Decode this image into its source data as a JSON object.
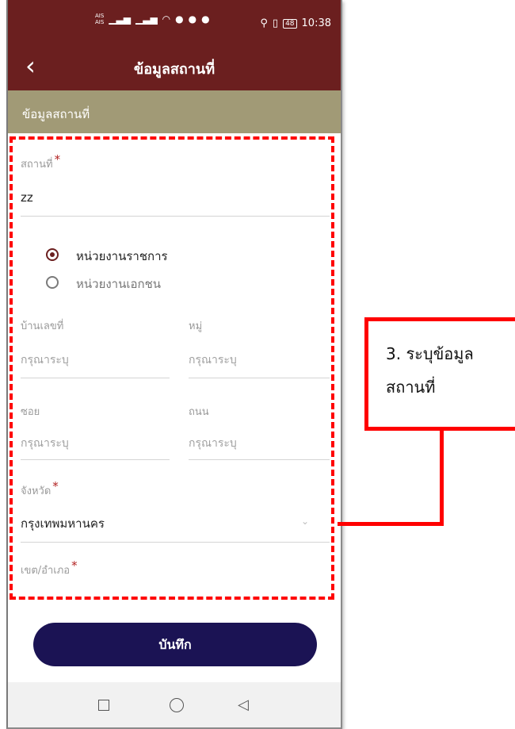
{
  "status_bar": {
    "carrier1": "AIS",
    "carrier2": "AIS",
    "battery": "48",
    "time": "10:38"
  },
  "app_bar": {
    "title": "ข้อมูลสถานที่"
  },
  "section": {
    "title": "ข้อมูลสถานที่"
  },
  "form": {
    "place": {
      "label": "สถานที่",
      "required": "*",
      "value": "zz"
    },
    "org_type": {
      "options": [
        {
          "label": "หน่วยงานราชการ",
          "selected": true
        },
        {
          "label": "หน่วยงานเอกชน",
          "selected": false
        }
      ]
    },
    "house_no": {
      "label": "บ้านเลขที่",
      "placeholder": "กรุณาระบุ"
    },
    "moo": {
      "label": "หมู่",
      "placeholder": "กรุณาระบุ"
    },
    "soi": {
      "label": "ซอย",
      "placeholder": "กรุณาระบุ"
    },
    "road": {
      "label": "ถนน",
      "placeholder": "กรุณาระบุ"
    },
    "province": {
      "label": "จังหวัด",
      "required": "*",
      "value": "กรุงเทพมหานคร"
    },
    "district": {
      "label": "เขต/อำเภอ",
      "required": "*"
    }
  },
  "save_label": "บันทึก",
  "annotation": {
    "line1": "3. ระบุข้อมูล",
    "line2": "สถานที่"
  },
  "colors": {
    "app_bar": "#6b1f1f",
    "section_header": "#a19a76",
    "save_button": "#1b1354",
    "annotation": "#ff0000"
  }
}
